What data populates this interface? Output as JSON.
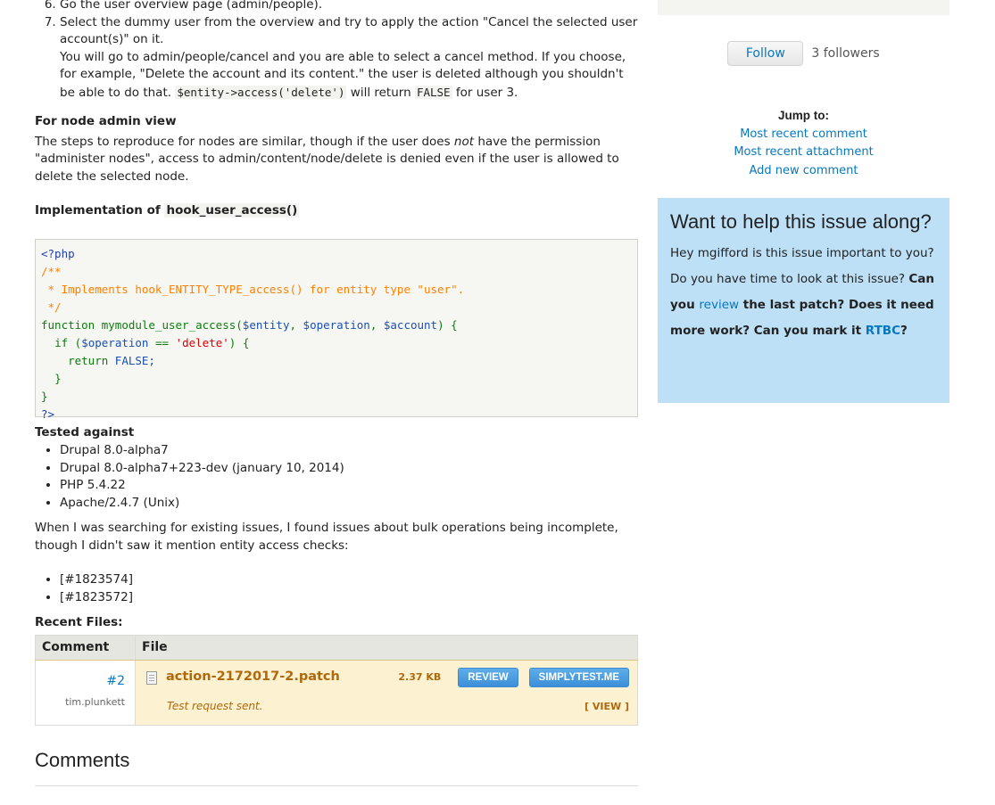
{
  "steps": [
    {
      "num": 6,
      "text": "Go the user overview page (admin/people)."
    },
    {
      "num": 7,
      "text": "Select the dummy user from the overview and try to apply the action \"Cancel the selected user account(s)\" on it.",
      "extra_before_code": "You will go to admin/people/cancel and you are able to select a cancel method. If you choose, for example, \"Delete the account and its content.\" the user is deleted although you shouldn't be able to do that. ",
      "code1": "$entity->access('delete')",
      "mid": " will return ",
      "code2": "FALSE",
      "end": " for user 3."
    }
  ],
  "node_admin": {
    "heading": "For node admin view",
    "text_before": "The steps to reproduce for nodes are similar, though if the user does ",
    "emphasis": "not",
    "text_after": " have the permission \"administer nodes\", access to admin/content/node/delete is denied even if the user is allowed to delete the selected node."
  },
  "implementation": {
    "label": "Implementation of ",
    "code": "hook_user_access()"
  },
  "code_block": {
    "open_tag": "<?php",
    "comment_lines": [
      "/**",
      " * Implements hook_ENTITY_TYPE_access() for entity type \"user\".",
      " */"
    ],
    "function_kw": "function",
    "function_name": " mymodule_user_access(",
    "args": [
      "$entity",
      "$operation",
      "$account"
    ],
    "if_kw": "if",
    "operation_var": "$operation",
    "compare": " == ",
    "delete_str": "'delete'",
    "return_kw": "return",
    "false_val": " FALSE;",
    "close_tag": "?>"
  },
  "tested_against": {
    "heading": "Tested against",
    "items": [
      "Drupal 8.0-alpha7",
      "Drupal 8.0-alpha7+223-dev (january 10, 2014)",
      "PHP 5.4.22",
      "Apache/2.4.7 (Unix)"
    ]
  },
  "searching_text": "When I was searching for existing issues, I found issues about bulk operations being incomplete, though I didn't saw it mention entity access checks:",
  "related_issues": [
    "[#1823574]",
    "[#1823572]"
  ],
  "recent_files": {
    "heading": "Recent Files:",
    "columns": [
      "Comment",
      "File"
    ],
    "rows": [
      {
        "comment_num": "#2",
        "user": "tim.plunkett",
        "file_name": "action-2172017-2.patch",
        "size": "2.37 KB",
        "review_label": "REVIEW",
        "simplytest_label": "SIMPLYTEST.ME",
        "status": "Test request sent.",
        "view_label": "[ VIEW ]"
      }
    ]
  },
  "comments_heading": "Comments",
  "sidebar": {
    "follow_label": "Follow",
    "followers": "3 followers",
    "jump_title": "Jump to:",
    "jump_links": [
      "Most recent comment",
      "Most recent attachment",
      "Add new comment"
    ],
    "help": {
      "title": "Want to help this issue along?",
      "text1": "Hey mgifford is this issue important to you? Do you have time to look at this issue? ",
      "bold1": "Can you ",
      "review_link": "review",
      "bold2": " the last patch? Does it need more work? Can you mark it ",
      "rtbc_link": "RTBC",
      "bold3": "?"
    }
  }
}
